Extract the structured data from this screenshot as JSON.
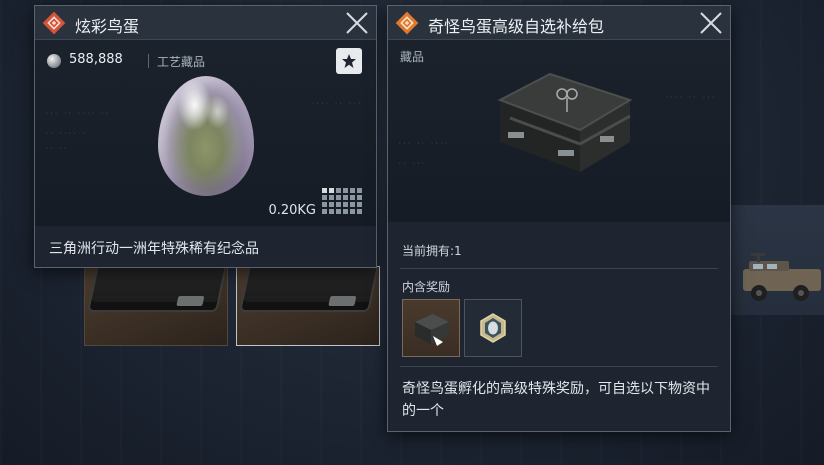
{
  "colors": {
    "rarity_red": "#d2553c",
    "rarity_orange": "#e07a2e",
    "panel_bg": "#1e2530",
    "header_bg": "#2a323d"
  },
  "left_panel": {
    "title": "炫彩鸟蛋",
    "rarity_icon": "red-diamond-icon",
    "price": "588,888",
    "category": "工艺藏品",
    "weight": "0.20KG",
    "grid_size": {
      "cols": 6,
      "rows": 4,
      "filled_cols": 2,
      "filled_rows": 1
    },
    "description": "三角洲行动一洲年特殊稀有纪念品"
  },
  "right_panel": {
    "title": "奇怪鸟蛋高级自选补给包",
    "rarity_icon": "orange-diamond-icon",
    "category": "藏品",
    "owned": "当前拥有:1",
    "rewards_label": "内含奖励",
    "rewards": [
      {
        "name": "crate-reward",
        "icon": "crate-icon"
      },
      {
        "name": "egg-box-reward",
        "icon": "egg-box-icon"
      }
    ],
    "description": "奇怪鸟蛋孵化的高级特殊奖励，可自选以下物资中的一个"
  }
}
